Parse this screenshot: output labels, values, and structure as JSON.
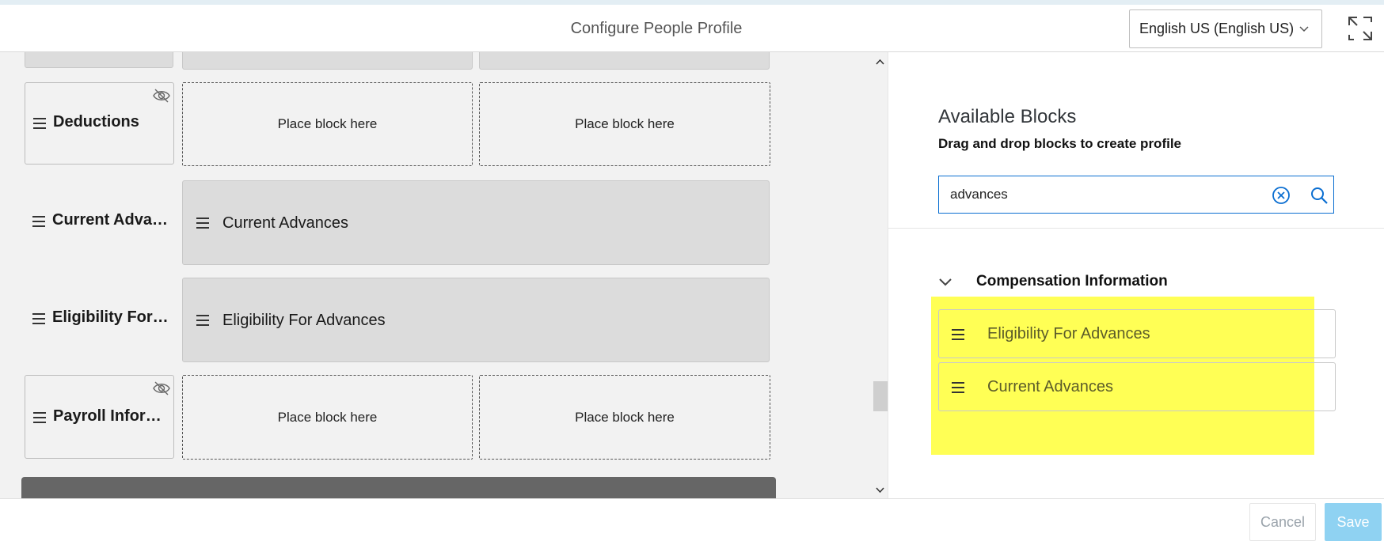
{
  "header": {
    "title": "Configure People Profile",
    "language": "English US (English US)"
  },
  "canvas": {
    "rows": [
      {
        "label": "Deductions",
        "hidden_icon": "eye-slash-icon",
        "placeholders": [
          "Place block here",
          "Place block here"
        ]
      },
      {
        "label": "Current Adva…",
        "block": "Current Advances"
      },
      {
        "label": "Eligibility For…",
        "block": "Eligibility For Advances"
      },
      {
        "label": "Payroll Infor…",
        "hidden_icon": "eye-slash-icon",
        "placeholders": [
          "Place block here",
          "Place block here"
        ]
      }
    ]
  },
  "panel": {
    "title": "Available Blocks",
    "subtitle": "Drag and drop blocks to create profile",
    "search_value": "advances",
    "group": {
      "title": "Compensation Information",
      "items": [
        "Eligibility For Advances",
        "Current Advances"
      ]
    },
    "highlight_color": "#ffff55"
  },
  "footer": {
    "cancel_label": "Cancel",
    "save_label": "Save"
  },
  "colors": {
    "accent": "#0a6ed1",
    "save_disabled": "#8fd2f2",
    "dark_bar": "#666666"
  }
}
